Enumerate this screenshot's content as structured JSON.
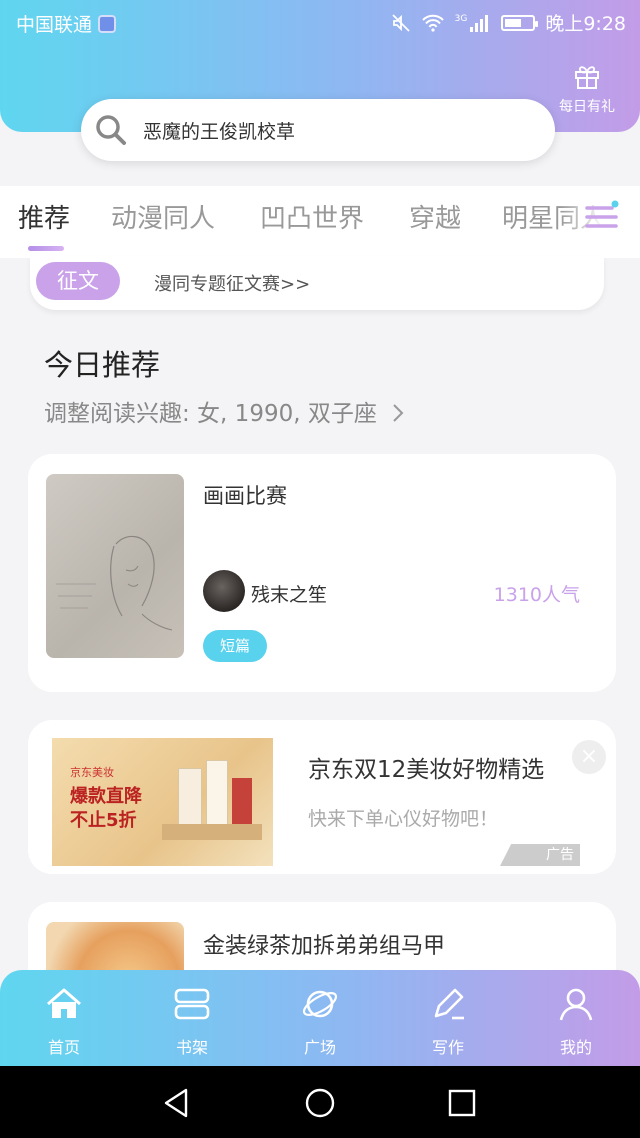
{
  "status_bar": {
    "carrier": "中国联通",
    "time": "晚上9:28",
    "network": "3G"
  },
  "header": {
    "gift_label": "每日有礼"
  },
  "search": {
    "query": "恶魔的王俊凯校草"
  },
  "tabs": [
    {
      "label": "推荐"
    },
    {
      "label": "动漫同人"
    },
    {
      "label": "凹凸世界"
    },
    {
      "label": "穿越"
    },
    {
      "label": "明星同人"
    }
  ],
  "contest": {
    "badge": "征文",
    "text": "漫同专题征文赛>>"
  },
  "recommend": {
    "title": "今日推荐",
    "subtitle": "调整阅读兴趣: 女, 1990, 双子座"
  },
  "cards": [
    {
      "title": "画画比赛",
      "author": "残末之笙",
      "popularity": "1310人气",
      "tag": "短篇"
    },
    {
      "title": "金装绿茶加拆弟弟组马甲"
    }
  ],
  "ad": {
    "title": "京东双12美妆好物精选",
    "subtitle": "快来下单心仪好物吧！",
    "label": "广告",
    "close": "×",
    "image_texts": {
      "brand": "京东美妆",
      "line1": "爆款直降",
      "line2": "不止5折"
    }
  },
  "bottom_nav": [
    {
      "label": "首页",
      "icon": "home-icon"
    },
    {
      "label": "书架",
      "icon": "bookshelf-icon"
    },
    {
      "label": "广场",
      "icon": "planet-icon"
    },
    {
      "label": "写作",
      "icon": "pen-icon"
    },
    {
      "label": "我的",
      "icon": "profile-icon"
    }
  ],
  "colors": {
    "accent_purple": "#c9a2ea",
    "accent_cyan": "#59d2ee",
    "gradient_start": "#5fd6f0",
    "gradient_end": "#c39ce8"
  }
}
